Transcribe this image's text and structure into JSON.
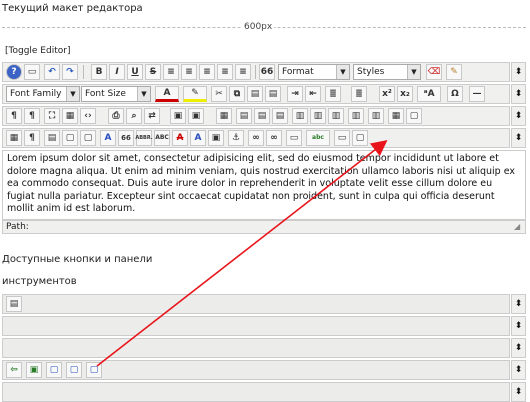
{
  "header": {
    "layout_title": "Текущий макет редактора",
    "width_label": "600px",
    "toggle_label": "[Toggle Editor]"
  },
  "toolbar1": {
    "format_select": "Format",
    "styles_select": "Styles",
    "icons": [
      "help-icon",
      "new-document-icon",
      "undo-icon",
      "redo-icon",
      "bold-icon",
      "italic-icon",
      "underline-icon",
      "strikethrough-icon",
      "justify-full-icon",
      "align-left-icon",
      "align-center-icon",
      "align-right-icon",
      "blockquote-icon",
      "clear-formatting-icon",
      "paint-brush-icon"
    ],
    "glyphs": {
      "bold": "B",
      "italic": "I",
      "underline": "U",
      "strike": "S",
      "quote": "66"
    }
  },
  "toolbar2": {
    "font_family_select": "Font Family",
    "font_size_select": "Font Size",
    "glyphs": {
      "sup": "x²",
      "sub": "x₂",
      "omega": "Ω",
      "font_color": "A",
      "case": "ᵃA"
    }
  },
  "toolbar3": {
    "glyphs": {
      "para_ltr": "¶",
      "para_rtl": "¶",
      "print": "🖶",
      "find": "⌕",
      "para": "¶",
      "abbr": "ABBR.",
      "acronym": "ABC",
      "insert_char": "A",
      "quote": "«»"
    }
  },
  "toolbar4": {
    "glyphs": {
      "para": "¶",
      "quote": "66",
      "abbr": "ABBR.",
      "abc": "ABC",
      "strike": "A",
      "spell": "abc"
    }
  },
  "editor": {
    "content": "Lorem ipsum dolor sit amet, consectetur adipisicing elit, sed do eiusmod tempor incididunt ut labore et dolore magna aliqua. Ut enim ad minim veniam, quis nostrud exercitation ullamco laboris nisi ut aliquip ex ea commodo consequat. Duis aute irure dolor in reprehenderit in voluptate velit esse cillum dolore eu fugiat nulla pariatur. Excepteur sint occaecat cupidatat non proident, sunt in culpa qui officia deserunt mollit anim id est laborum.",
    "path_label": "Path:"
  },
  "available": {
    "label_line1": "Доступные кнопки и панели",
    "label_line2": "инструментов"
  },
  "row_handle_glyph": "⬍",
  "colors": {
    "arrow": "#e8141a",
    "toolbar_bg": "#f0f0ee",
    "border": "#cccccc"
  }
}
